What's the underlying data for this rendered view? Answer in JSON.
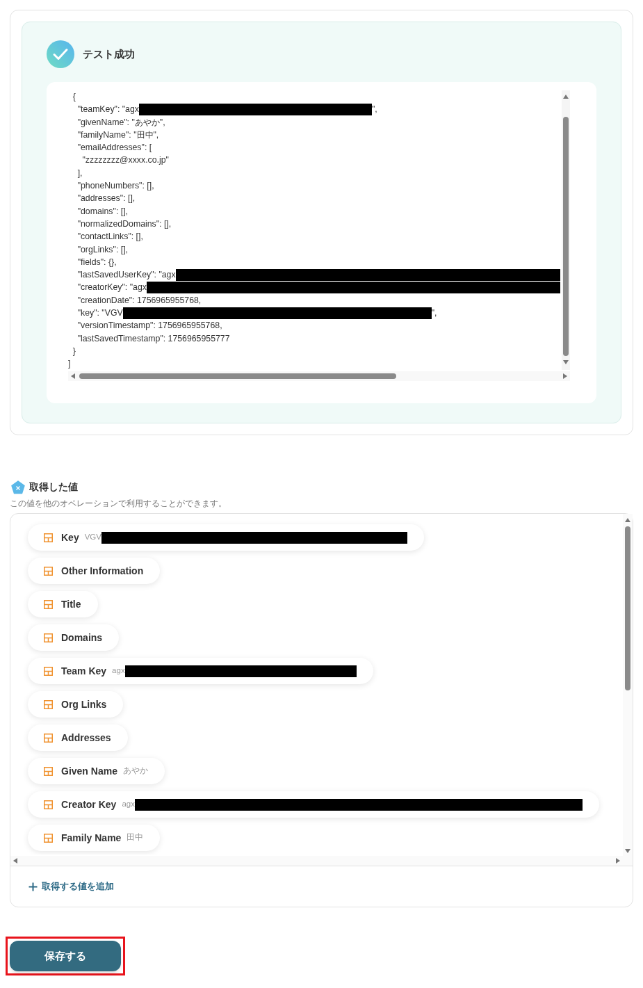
{
  "test_result": {
    "title": "テスト成功",
    "code_lines": [
      {
        "text": "  {"
      },
      {
        "text": "    \"teamKey\": \"agx",
        "redacted": true,
        "after": "\","
      },
      {
        "text": "    \"givenName\": \"あやか\","
      },
      {
        "text": "    \"familyName\": \"田中\","
      },
      {
        "text": "    \"emailAddresses\": ["
      },
      {
        "text": "      \"zzzzzzzz@xxxx.co.jp\""
      },
      {
        "text": "    ],"
      },
      {
        "text": "    \"phoneNumbers\": [],"
      },
      {
        "text": "    \"addresses\": [],"
      },
      {
        "text": "    \"domains\": [],"
      },
      {
        "text": "    \"normalizedDomains\": [],"
      },
      {
        "text": "    \"contactLinks\": [],"
      },
      {
        "text": "    \"orgLinks\": [],"
      },
      {
        "text": "    \"fields\": {},"
      },
      {
        "text": "    \"lastSavedUserKey\": \"agx",
        "redacted": true
      },
      {
        "text": "    \"creatorKey\": \"agx",
        "redacted": true
      },
      {
        "text": "    \"creationDate\": 1756965955768,"
      },
      {
        "text": "    \"key\": \"VGV",
        "redacted": true,
        "after": "\","
      },
      {
        "text": "    \"versionTimestamp\": 1756965955768,"
      },
      {
        "text": "    \"lastSavedTimestamp\": 1756965955777"
      },
      {
        "text": "  }"
      },
      {
        "text": "]"
      }
    ]
  },
  "values_section": {
    "title": "取得した値",
    "description": "この値を他のオペレーションで利用することができます。",
    "items": [
      {
        "label": "Key",
        "value": "VGV",
        "redacted": true
      },
      {
        "label": "Other Information"
      },
      {
        "label": "Title"
      },
      {
        "label": "Domains"
      },
      {
        "label": "Team Key",
        "value": "agx",
        "redacted": true
      },
      {
        "label": "Org Links"
      },
      {
        "label": "Addresses"
      },
      {
        "label": "Given Name",
        "value": "あやか"
      },
      {
        "label": "Creator Key",
        "value": "agx",
        "redacted": true
      },
      {
        "label": "Family Name",
        "value": "田中"
      }
    ],
    "add_link": "取得する値を追加"
  },
  "save_button": {
    "label": "保存する",
    "highlighted": true
  }
}
